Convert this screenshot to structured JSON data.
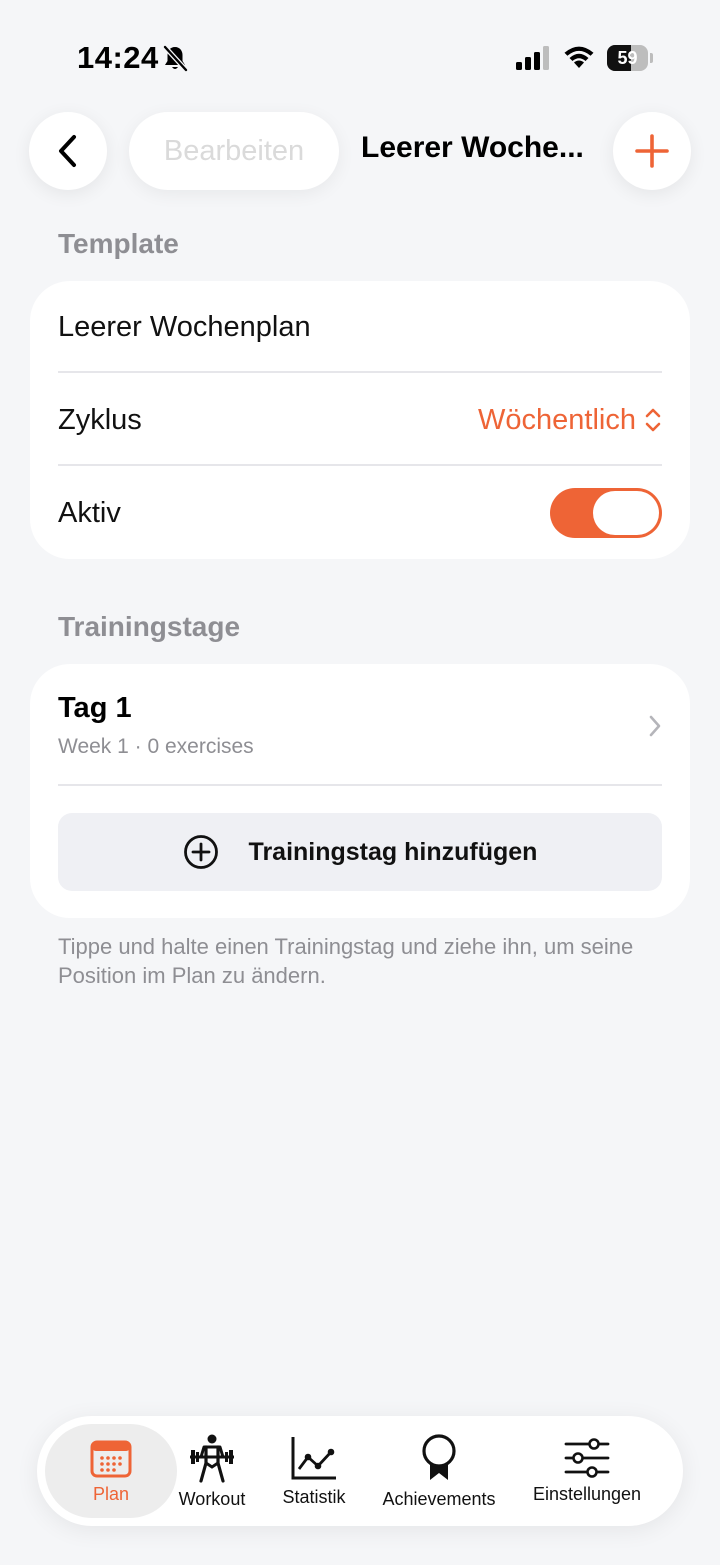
{
  "status_bar": {
    "time": "14:24",
    "battery": "59",
    "battery_level": 0.59
  },
  "nav": {
    "edit_label": "Bearbeiten",
    "title": "Leerer Woche..."
  },
  "template_section": {
    "header": "Template",
    "name": "Leerer Wochenplan",
    "cycle_label": "Zyklus",
    "cycle_value": "Wöchentlich",
    "active_label": "Aktiv",
    "active": true
  },
  "training_section": {
    "header": "Trainingstage",
    "days": [
      {
        "title": "Tag 1",
        "subtitle": "Week 1 · 0 exercises"
      }
    ],
    "add_label": "Trainingstag hinzufügen",
    "hint": "Tippe und halte einen Trainingstag und ziehe ihn, um seine Position im Plan zu ändern."
  },
  "tabs": [
    {
      "label": "Plan",
      "icon": "calendar-icon",
      "active": true
    },
    {
      "label": "Workout",
      "icon": "weightlifter-icon",
      "active": false
    },
    {
      "label": "Statistik",
      "icon": "line-chart-icon",
      "active": false
    },
    {
      "label": "Achievements",
      "icon": "medal-icon",
      "active": false
    },
    {
      "label": "Einstellungen",
      "icon": "sliders-icon",
      "active": false
    }
  ],
  "colors": {
    "accent": "#EE6436",
    "background": "#F5F6F8",
    "secondary_text": "#8E8E93"
  }
}
